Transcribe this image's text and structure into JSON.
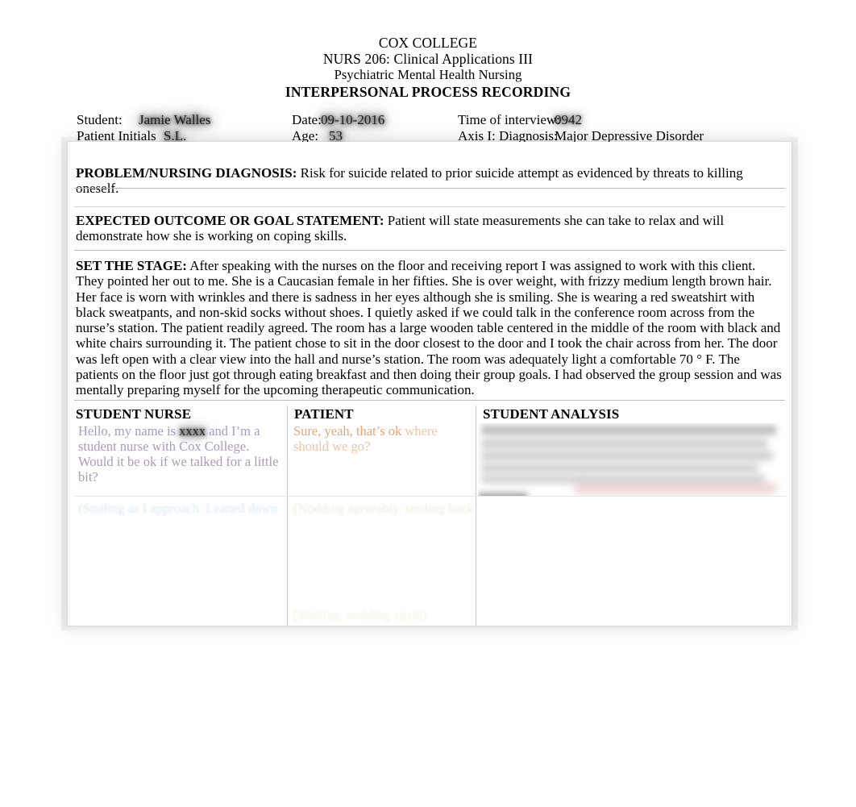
{
  "header": {
    "institution": "COX COLLEGE",
    "course": "NURS 206: Clinical Applications III",
    "subject": "Psychiatric Mental Health Nursing",
    "doc_title": "INTERPERSONAL PROCESS RECORDING"
  },
  "meta": {
    "student_label": "Student:",
    "student_value": "Jamie Walles",
    "date_label": "Date:",
    "date_value": "09-10-2016",
    "time_label": "Time of interview:",
    "time_value": "0942",
    "patient_initials_label": "Patient Initials",
    "patient_initials_value": "S.L.",
    "age_label": "Age:",
    "age_value": "53",
    "axis_label": "Axis I: Diagnosis:",
    "axis_value": "Major Depressive Disorder",
    "stray_dash": "–"
  },
  "sections": {
    "problem": {
      "label": "PROBLEM/NURSING DIAGNOSIS:",
      "text": "  Risk for suicide related to prior suicide attempt as evidenced by threats to killing oneself."
    },
    "outcome": {
      "label": "EXPECTED OUTCOME OR GOAL STATEMENT:",
      "text": " Patient will state measurements she can take to relax and will demonstrate how she is working on coping skills."
    },
    "stage": {
      "label": "SET THE STAGE:",
      "text": " After speaking with the nurses on the floor and receiving report I was assigned to work with this client.  They pointed her out to me. She is a Caucasian female in her fifties. She is over weight, with frizzy medium length brown hair. Her face is worn with wrinkles and there is sadness in her eyes although she is smiling. She is wearing a red sweatshirt with black sweatpants, and non-skid socks without shoes.  I quietly asked if we could talk in the conference room across from the nurse’s station.  The patient readily agreed. The room has a large wooden table centered in the middle of the room with black and white chairs surrounding it. The patient chose to sit in the door closest to the door and I took the chair across from her. The door was left open with a clear view into the hall and nurse’s station.  The room was adequately light a comfortable 70 ° F.  The patients on the floor just got through eating breakfast and then doing their group goals. I had observed the group session and was mentally preparing myself for the upcoming therapeutic communication."
    }
  },
  "table": {
    "headers": {
      "student_nurse": " STUDENT NURSE",
      "patient": "PATIENT",
      "student_analysis": "STUDENT ANALYSIS"
    },
    "rows": [
      {
        "student_nurse_pre": "Hello, my name is ",
        "student_nurse_redacted": "xxxx",
        "student_nurse_post": " and I’m a student nurse with Cox College. Would it be ok if we talked for a little bit?",
        "patient_strong": "Sure, yeah, that’s ok",
        "patient_weak": " where should we go?",
        "student_analysis": ""
      },
      {
        "student_nurse": "(Smiling as I approach. Leaned down",
        "patient": "(Nodding agreeably, smiling back",
        "patient_bottom": "(Smiling, nodding again)",
        "student_analysis": ""
      }
    ]
  },
  "colors": {
    "student_nurse_text": "#a89cc0",
    "patient_text_strong": "#e8a475",
    "patient_text_weak": "#f0c3a2",
    "page_background": "#ffffff",
    "rule": "#bdbdbd"
  }
}
